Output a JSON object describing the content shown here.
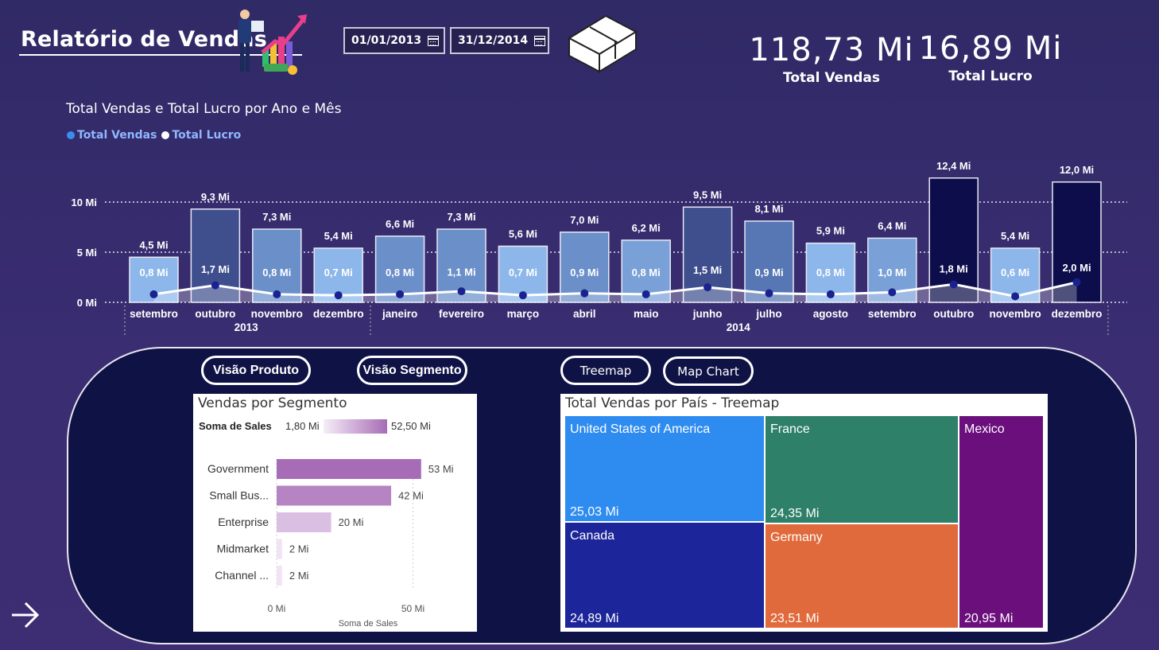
{
  "header": {
    "title": "Relatório de Vendas",
    "start_date": "01/01/2013",
    "end_date": "31/12/2014"
  },
  "kpis": [
    {
      "value": "118,73 Mi",
      "label": "Total Vendas"
    },
    {
      "value": "16,89 Mi",
      "label": "Total Lucro"
    }
  ],
  "colors": {
    "background": "#302a66",
    "vendas_legend": "#3a8ef0",
    "lucro_legend": "#ffffff",
    "panel": "#0f1245"
  },
  "chart_data": {
    "type": "bar",
    "title": "Total Vendas e Total Lucro por Ano e Mês",
    "legend": [
      {
        "name": "Total Vendas",
        "color": "#3a8ef0"
      },
      {
        "name": "Total Lucro",
        "color": "#ffffff"
      }
    ],
    "legend_position": "top-left",
    "y_ticks": [
      "10 Mi",
      "5 Mi",
      "0 Mi"
    ],
    "ylim": [
      0,
      12.4
    ],
    "grid": true,
    "categories": [
      "setembro",
      "outubro",
      "novembro",
      "dezembro",
      "janeiro",
      "fevereiro",
      "março",
      "abril",
      "maio",
      "junho",
      "julho",
      "agosto",
      "setembro",
      "outubro",
      "novembro",
      "dezembro"
    ],
    "years": [
      {
        "label": "2013",
        "start": 0,
        "end": 3
      },
      {
        "label": "2014",
        "start": 4,
        "end": 15
      }
    ],
    "series": [
      {
        "name": "Total Vendas",
        "type": "bar",
        "values": [
          4.5,
          9.3,
          7.3,
          5.4,
          6.6,
          7.3,
          5.6,
          7.0,
          6.2,
          9.5,
          8.1,
          5.9,
          6.4,
          12.4,
          5.4,
          12.0
        ],
        "labels": [
          "4,5 Mi",
          "9,3 Mi",
          "7,3 Mi",
          "5,4 Mi",
          "6,6 Mi",
          "7,3 Mi",
          "5,6 Mi",
          "7,0 Mi",
          "6,2 Mi",
          "9,5 Mi",
          "8,1 Mi",
          "5,9 Mi",
          "6,4 Mi",
          "12,4 Mi",
          "5,4 Mi",
          "12,0 Mi"
        ]
      },
      {
        "name": "Total Lucro",
        "type": "line",
        "values": [
          0.8,
          1.7,
          0.8,
          0.7,
          0.8,
          1.1,
          0.7,
          0.9,
          0.8,
          1.5,
          0.9,
          0.8,
          1.0,
          1.8,
          0.6,
          2.0
        ],
        "labels": [
          "0,8 Mi",
          "1,7 Mi",
          "0,8 Mi",
          "0,7 Mi",
          "0,8 Mi",
          "1,1 Mi",
          "0,7 Mi",
          "0,9 Mi",
          "0,8 Mi",
          "1,5 Mi",
          "0,9 Mi",
          "0,8 Mi",
          "1,0 Mi",
          "1,8 Mi",
          "0,6 Mi",
          "2,0 Mi"
        ]
      }
    ]
  },
  "buttons": {
    "visao_produto": "Visão Produto",
    "visao_segmento": "Visão Segmento",
    "treemap": "Treemap",
    "map_chart": "Map Chart"
  },
  "segment_chart": {
    "title": "Vendas por Segmento",
    "legend_label": "Soma de  Sales",
    "legend_min": "1,80 Mi",
    "legend_max": "52,50 Mi",
    "categories": [
      "Government",
      "Small Bus...",
      "Enterprise",
      "Midmarket",
      "Channel ..."
    ],
    "values": [
      53,
      42,
      20,
      2,
      2
    ],
    "value_labels": [
      "53 Mi",
      "42 Mi",
      "20 Mi",
      "2 Mi",
      "2 Mi"
    ],
    "colors": [
      "#a76cb6",
      "#b684c2",
      "#dbbfe3",
      "#f1e3f4",
      "#f1e3f4"
    ],
    "x_ticks": [
      "0 Mi",
      "50 Mi"
    ],
    "xlim": [
      0,
      60
    ],
    "xlabel": "Soma de Sales"
  },
  "treemap": {
    "title": "Total Vendas por País - Treemap",
    "cells": [
      {
        "country": "United States of America",
        "value": "25,03 Mi",
        "color": "#2e8cf0"
      },
      {
        "country": "France",
        "value": "24,35 Mi",
        "color": "#2e8068"
      },
      {
        "country": "Mexico",
        "value": "20,95 Mi",
        "color": "#6b0f7c"
      },
      {
        "country": "Canada",
        "value": "24,89 Mi",
        "color": "#1c2599"
      },
      {
        "country": "Germany",
        "value": "23,51 Mi",
        "color": "#e16a3c"
      }
    ]
  }
}
